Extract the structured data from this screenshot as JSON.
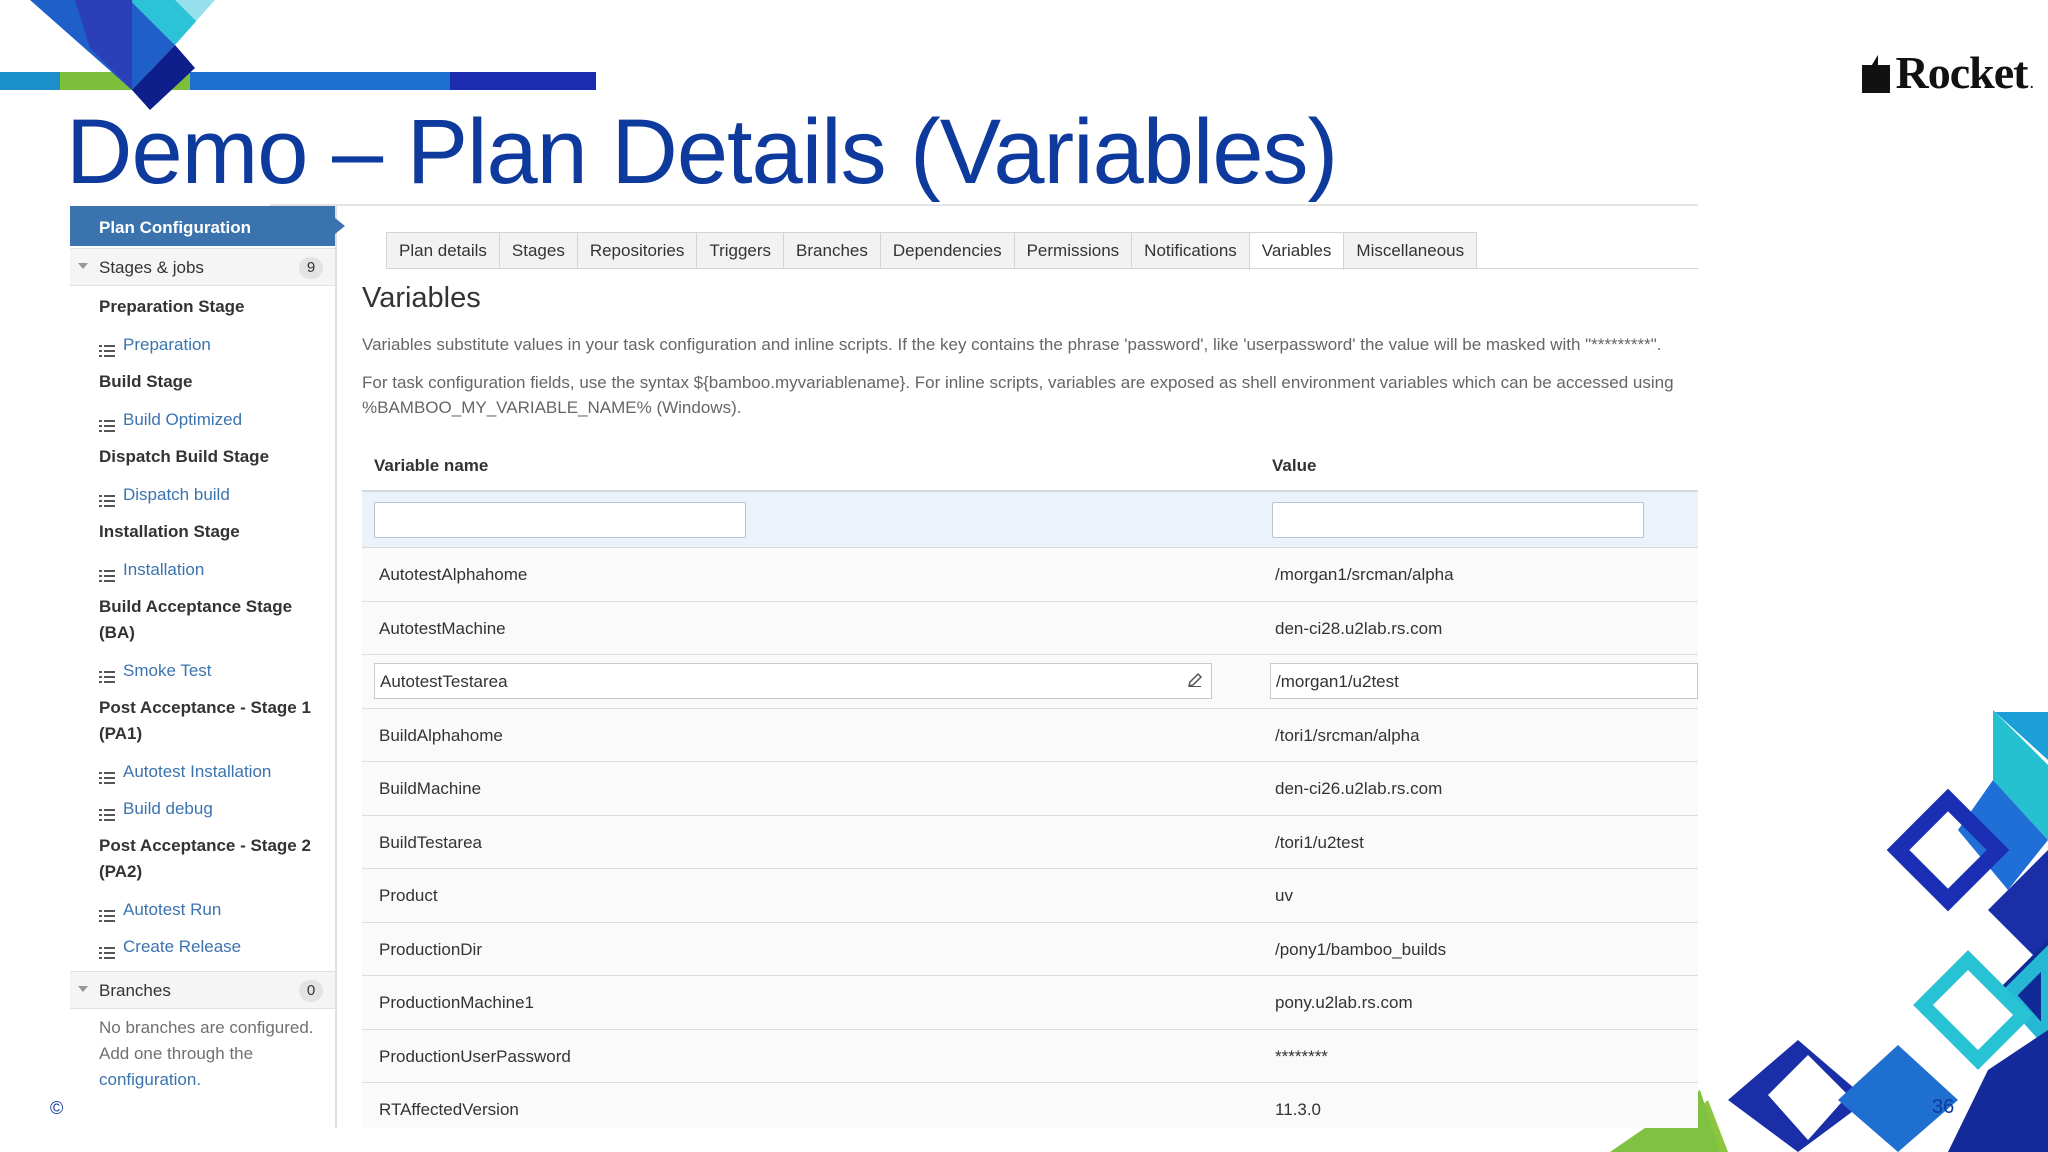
{
  "slide": {
    "title": "Demo – Plan Details (Variables)",
    "logo_text": "Rocket",
    "logo_dot": ".",
    "copyright": "©",
    "page_number": "36",
    "colors": {
      "title": "#0d3a9c",
      "accent_blue": "#3b73af"
    }
  },
  "sidebar": {
    "header": "Plan Configuration",
    "stages_label": "Stages & jobs",
    "stages_count": "9",
    "stages": [
      {
        "name": "Preparation Stage",
        "jobs": [
          "Preparation"
        ]
      },
      {
        "name": "Build Stage",
        "jobs": [
          "Build Optimized"
        ]
      },
      {
        "name": "Dispatch Build Stage",
        "jobs": [
          "Dispatch build"
        ]
      },
      {
        "name": "Installation Stage",
        "jobs": [
          "Installation"
        ]
      },
      {
        "name": "Build Acceptance Stage (BA)",
        "jobs": [
          "Smoke Test"
        ]
      },
      {
        "name": "Post Acceptance - Stage 1 (PA1)",
        "jobs": [
          "Autotest Installation",
          "Build debug"
        ]
      },
      {
        "name": "Post Acceptance - Stage 2 (PA2)",
        "jobs": [
          "Autotest Run",
          "Create Release"
        ]
      }
    ],
    "branches_label": "Branches",
    "branches_count": "0",
    "branches_note": "No branches are configured. Add one through the",
    "branches_link": "configuration."
  },
  "tabs": [
    "Plan details",
    "Stages",
    "Repositories",
    "Triggers",
    "Branches",
    "Dependencies",
    "Permissions",
    "Notifications",
    "Variables",
    "Miscellaneous"
  ],
  "active_tab": "Variables",
  "variables": {
    "title": "Variables",
    "desc1": "Variables substitute values in your task configuration and inline scripts. If the key contains the phrase 'password', like 'userpassword' the value will be masked with \"*********\".",
    "desc2": "For task configuration fields, use the syntax ${bamboo.myvariablename}. For inline scripts, variables are exposed as shell environment variables which can be accessed using",
    "desc3": "%BAMBOO_MY_VARIABLE_NAME% (Windows).",
    "col_name": "Variable name",
    "col_value": "Value",
    "rows": [
      {
        "name": "AutotestAlphahome",
        "value": "/morgan1/srcman/alpha"
      },
      {
        "name": "AutotestMachine",
        "value": "den-ci28.u2lab.rs.com"
      },
      {
        "name": "AutotestTestarea",
        "value": "/morgan1/u2test"
      },
      {
        "name": "BuildAlphahome",
        "value": "/tori1/srcman/alpha"
      },
      {
        "name": "BuildMachine",
        "value": "den-ci26.u2lab.rs.com"
      },
      {
        "name": "BuildTestarea",
        "value": "/tori1/u2test"
      },
      {
        "name": "Product",
        "value": "uv"
      },
      {
        "name": "ProductionDir",
        "value": "/pony1/bamboo_builds"
      },
      {
        "name": "ProductionMachine1",
        "value": "pony.u2lab.rs.com"
      },
      {
        "name": "ProductionUserPassword",
        "value": "********"
      },
      {
        "name": "RTAffectedVersion",
        "value": "11.3.0"
      }
    ]
  }
}
